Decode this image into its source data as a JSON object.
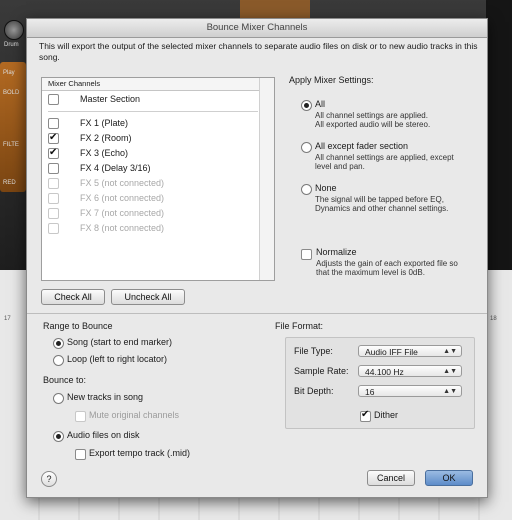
{
  "background": {
    "knob_label": "Drum",
    "tab_play": "Play",
    "tab_bold": "BOLD",
    "filter": "FILTE",
    "red": "RED",
    "ruler_1": "17",
    "ruler_2": "18"
  },
  "dialog": {
    "title": "Bounce Mixer Channels",
    "intro": "This will export the output of the selected mixer channels to separate audio files on disk or to new audio tracks in this song.",
    "list_header": "Mixer Channels",
    "channels": [
      {
        "label": "Master Section",
        "checked": false,
        "enabled": true
      },
      {
        "label": "FX 1 (Plate)",
        "checked": false,
        "enabled": true
      },
      {
        "label": "FX 2 (Room)",
        "checked": true,
        "enabled": true
      },
      {
        "label": "FX 3 (Echo)",
        "checked": true,
        "enabled": true
      },
      {
        "label": "FX 4 (Delay 3/16)",
        "checked": false,
        "enabled": true
      },
      {
        "label": "FX 5 (not connected)",
        "checked": false,
        "enabled": false
      },
      {
        "label": "FX 6 (not connected)",
        "checked": false,
        "enabled": false
      },
      {
        "label": "FX 7 (not connected)",
        "checked": false,
        "enabled": false
      },
      {
        "label": "FX 8 (not connected)",
        "checked": false,
        "enabled": false
      }
    ],
    "check_all": "Check All",
    "uncheck_all": "Uncheck All",
    "apply_heading": "Apply Mixer Settings:",
    "apply_options": [
      {
        "label": "All",
        "desc1": "All channel settings are applied.",
        "desc2": "All exported audio will be stereo.",
        "selected": true
      },
      {
        "label": "All except fader section",
        "desc1": "All channel settings are applied, except",
        "desc2": "level and pan.",
        "selected": false
      },
      {
        "label": "None",
        "desc1": "The signal will be tapped before EQ,",
        "desc2": "Dynamics and other channel settings.",
        "selected": false
      }
    ],
    "normalize": {
      "label": "Normalize",
      "desc1": "Adjusts the gain of each exported file so",
      "desc2": "that the maximum level is 0dB.",
      "checked": false
    },
    "range_heading": "Range to Bounce",
    "range_song": "Song (start to end marker)",
    "range_loop": "Loop (left to right locator)",
    "bounce_heading": "Bounce to:",
    "new_tracks": "New tracks in song",
    "mute_original": "Mute original channels",
    "audio_files": "Audio files on disk",
    "export_tempo": "Export tempo track (.mid)",
    "format_heading": "File Format:",
    "file_type_label": "File Type:",
    "file_type_value": "Audio IFF File",
    "sample_rate_label": "Sample Rate:",
    "sample_rate_value": "44.100 Hz",
    "bit_depth_label": "Bit Depth:",
    "bit_depth_value": "16",
    "dither": "Dither",
    "cancel": "Cancel",
    "ok": "OK",
    "help": "?"
  }
}
